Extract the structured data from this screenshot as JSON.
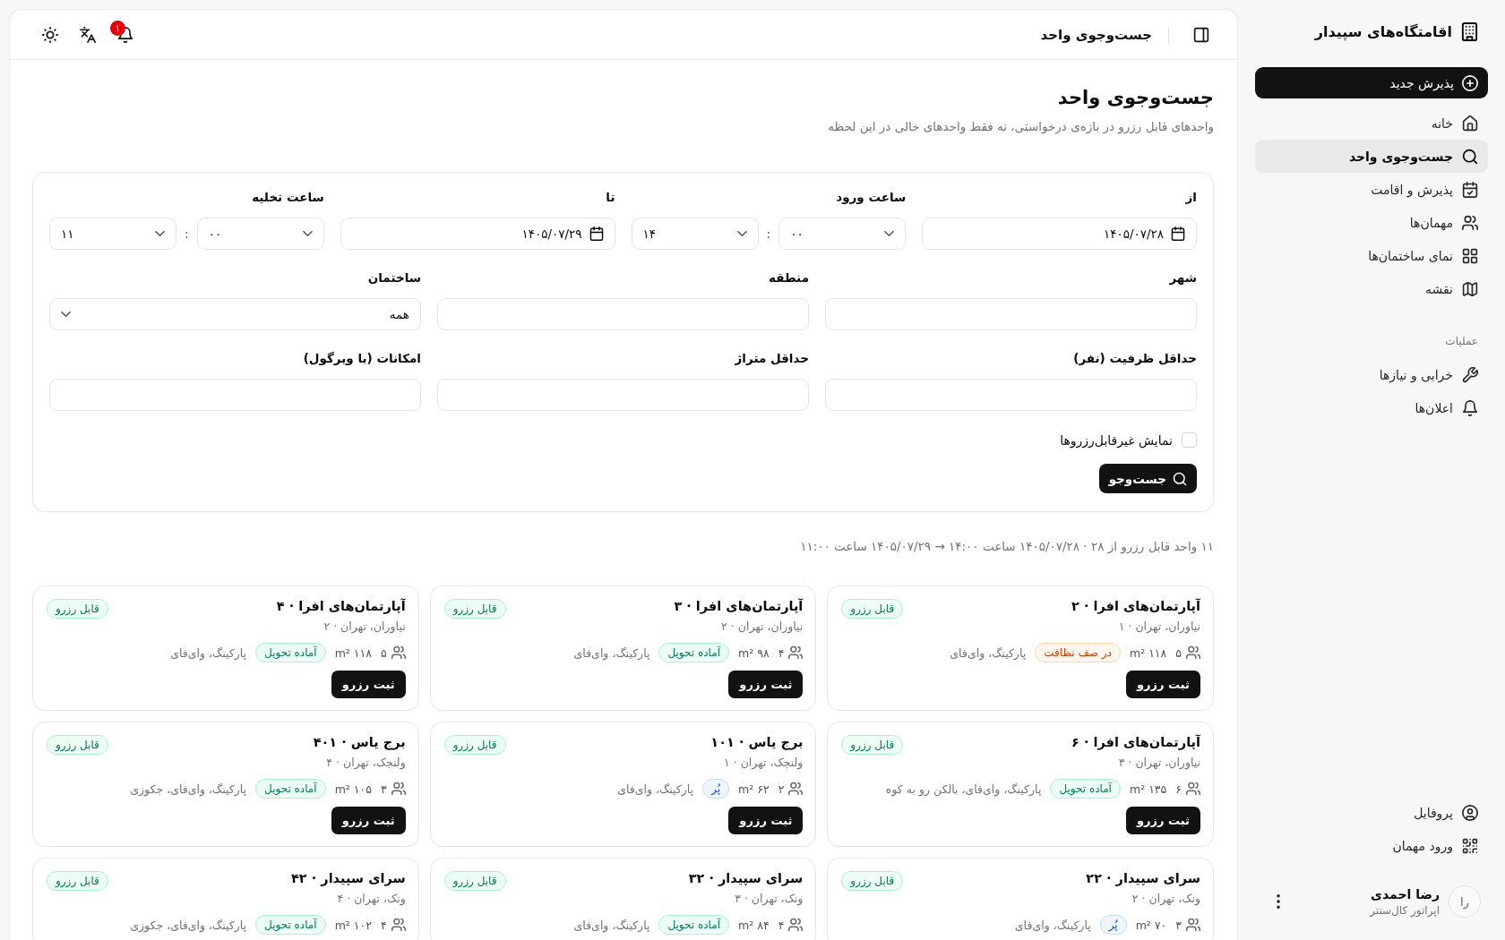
{
  "sidebar": {
    "brand": "اقامتگاه‌های سپیدار",
    "primary_action": "پذیرش جدید",
    "items": [
      {
        "label": "خانه",
        "selected": false
      },
      {
        "label": "جست‌وجوی واحد",
        "selected": true
      },
      {
        "label": "پذیرش و اقامت",
        "selected": false
      },
      {
        "label": "مهمان‌ها",
        "selected": false
      },
      {
        "label": "نمای ساختمان‌ها",
        "selected": false
      },
      {
        "label": "نقشه",
        "selected": false
      }
    ],
    "section": {
      "title": "عملیات",
      "items": [
        {
          "label": "خرابی و نیازها",
          "selected": false
        },
        {
          "label": "اعلان‌ها",
          "selected": false
        }
      ]
    },
    "footer_items": [
      {
        "label": "پروفایل",
        "selected": false
      },
      {
        "label": "ورود مهمان",
        "selected": false
      }
    ],
    "user": {
      "initials": "را",
      "name": "رضا احمدی",
      "role": "اپراتور کال‌سنتر"
    }
  },
  "header": {
    "title": "جست‌وجوی واحد",
    "notification_count": "۱"
  },
  "page": {
    "title": "جست‌وجوی واحد",
    "subtitle": "واحدهای قابل رزرو در بازه‌ی درخواستی، نه فقط واحدهای خالی در این لحظه"
  },
  "search_form": {
    "check_in_date": {
      "label": "از",
      "value": "۱۴۰۵/۰۷/۲۸"
    },
    "check_in_time": {
      "label": "ساعت ورود",
      "hour": "۱۴",
      "separator": ":",
      "minute": "۰۰"
    },
    "check_out_date": {
      "label": "تا",
      "value": "۱۴۰۵/۰۷/۲۹"
    },
    "check_out_time": {
      "label": "ساعت تخلیه",
      "hour": "۱۱",
      "separator": ":",
      "minute": "۰۰"
    },
    "city": {
      "label": "شهر"
    },
    "district": {
      "label": "منطقه"
    },
    "building": {
      "label": "ساختمان",
      "value": "همه"
    },
    "min_capacity": {
      "label": "حداقل ظرفیت (نفر)"
    },
    "min_area": {
      "label": "حداقل متراژ"
    },
    "amenities": {
      "label": "امکانات (با ویرگول)"
    },
    "show_unavailable": {
      "label": "نمایش غیرقابل‌رزروها",
      "checked": false
    },
    "submit": "جست‌وجو"
  },
  "results": {
    "summary": "۱۱ واحد قابل رزرو از ۲۸ · ۱۴۰۵/۰۷/۲۸ ساعت ۱۴:۰۰ → ۱۴۰۵/۰۷/۲۹ ساعت ۱۱:۰۰",
    "units": [
      {
        "title": "آپارتمان‌های افرا · ۲",
        "location": "نیاوران، تهران · ۱",
        "availability": "قابل رزرو",
        "capacity": "۵",
        "area": "۱۱۸ m²",
        "status": {
          "label": "در صف نظافت",
          "kind": "cleaning"
        },
        "amenities": "پارکینگ، وای‌فای",
        "action": "ثبت رزرو"
      },
      {
        "title": "آپارتمان‌های افرا · ۳",
        "location": "نیاوران، تهران · ۲",
        "availability": "قابل رزرو",
        "capacity": "۴",
        "area": "۹۸ m²",
        "status": {
          "label": "آماده تحویل",
          "kind": "ready"
        },
        "amenities": "پارکینگ، وای‌فای",
        "action": "ثبت رزرو"
      },
      {
        "title": "آپارتمان‌های افرا · ۴",
        "location": "نیاوران، تهران · ۲",
        "availability": "قابل رزرو",
        "capacity": "۵",
        "area": "۱۱۸ m²",
        "status": {
          "label": "آماده تحویل",
          "kind": "ready"
        },
        "amenities": "پارکینگ، وای‌فای",
        "action": "ثبت رزرو"
      },
      {
        "title": "آپارتمان‌های افرا · ۶",
        "location": "نیاوران، تهران · ۳",
        "availability": "قابل رزرو",
        "capacity": "۶",
        "area": "۱۳۵ m²",
        "status": {
          "label": "آماده تحویل",
          "kind": "ready"
        },
        "amenities": "پارکینگ، وای‌فای، بالکن رو به کوه",
        "action": "ثبت رزرو"
      },
      {
        "title": "برج یاس · ۱۰۱",
        "location": "ولنجک، تهران · ۱",
        "availability": "قابل رزرو",
        "capacity": "۲",
        "area": "۶۲ m²",
        "status": {
          "label": "پُر",
          "kind": "occupied"
        },
        "amenities": "پارکینگ، وای‌فای",
        "action": "ثبت رزرو"
      },
      {
        "title": "برج یاس · ۴۰۱",
        "location": "ولنجک، تهران · ۴",
        "availability": "قابل رزرو",
        "capacity": "۳",
        "area": "۱۰۵ m²",
        "status": {
          "label": "آماده تحویل",
          "kind": "ready"
        },
        "amenities": "پارکینگ، وای‌فای، جکوزی",
        "action": "ثبت رزرو"
      },
      {
        "title": "سرای سپیدار · ۲۲",
        "location": "ونک، تهران · ۲",
        "availability": "قابل رزرو",
        "capacity": "۳",
        "area": "۷۰ m²",
        "status": {
          "label": "پُر",
          "kind": "occupied"
        },
        "amenities": "پارکینگ، وای‌فای"
      },
      {
        "title": "سرای سپیدار · ۳۲",
        "location": "ونک، تهران · ۳",
        "availability": "قابل رزرو",
        "capacity": "۴",
        "area": "۸۴ m²",
        "status": {
          "label": "آماده تحویل",
          "kind": "ready"
        },
        "amenities": "پارکینگ، وای‌فای"
      },
      {
        "title": "سرای سپیدار · ۴۲",
        "location": "ونک، تهران · ۴",
        "availability": "قابل رزرو",
        "capacity": "۴",
        "area": "۱۰۲ m²",
        "status": {
          "label": "آماده تحویل",
          "kind": "ready"
        },
        "amenities": "پارکینگ، وای‌فای، جکوزی"
      }
    ]
  }
}
